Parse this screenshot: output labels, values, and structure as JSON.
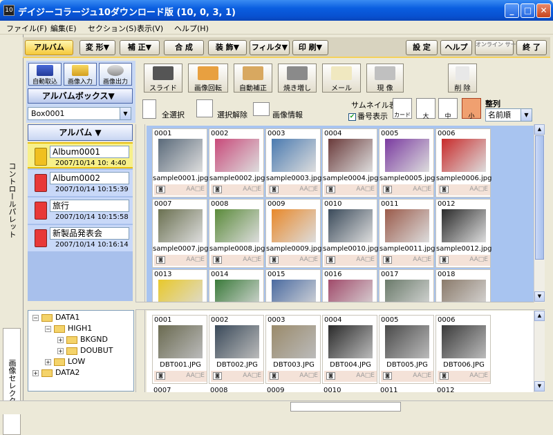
{
  "window": {
    "title": "デイジーコラージュ10ダウンロード版 (10, 0, 3, 1)",
    "app_icon": "10",
    "minimize": "_",
    "maximize": "□",
    "close": "✕"
  },
  "menu": [
    "ファイル(F)",
    "編集(E)",
    "セクション(S)",
    "表示(V)",
    "ヘルプ(H)"
  ],
  "tabs": [
    "アルバム",
    "変 形▼",
    "補 正▼",
    "合 成",
    "装 飾▼",
    "フィルタ▼",
    "印 刷▼"
  ],
  "right_tabs": [
    "設 定",
    "ヘルプ",
    "オンライン サービス",
    "終 了"
  ],
  "left_tools": [
    "自動取込",
    "画像入力",
    "画像出力"
  ],
  "albumbox_label": "アルバムボックス▼",
  "box_select": "Box0001",
  "tools": [
    "スライド",
    "画像回転",
    "自動補正",
    "焼き増し",
    "メール",
    "現 像",
    "削 除"
  ],
  "selection": {
    "select_all": "全選択",
    "deselect": "選択解除",
    "info": "画像情報"
  },
  "thumbnail_display": "サムネイル表示",
  "number_display": "番号表示",
  "card_btn": "カード",
  "size_btns": [
    "大",
    "中",
    "小"
  ],
  "sort": {
    "label": "整列",
    "value": "名前順"
  },
  "album_header": "アルバム ▼",
  "albums": [
    {
      "name": "Album0001",
      "date": "2007/10/14 10: 4:40"
    },
    {
      "name": "Album0002",
      "date": "2007/10/14 10:15:39"
    },
    {
      "name": "旅行",
      "date": "2007/10/14 10:15:58"
    },
    {
      "name": "新製品発表会",
      "date": "2007/10/14 10:16:14"
    }
  ],
  "left_vertical_tabs": [
    "コントロールパレット",
    "画像セレクタ"
  ],
  "thumbnails": [
    {
      "num": "0001",
      "file": "sample0001.jpg",
      "color": "#5a6a7a"
    },
    {
      "num": "0002",
      "file": "sample0002.jpg",
      "color": "#c84a7a"
    },
    {
      "num": "0003",
      "file": "sample0003.jpg",
      "color": "#4a7ab0"
    },
    {
      "num": "0004",
      "file": "sample0004.jpg",
      "color": "#6a3a3a"
    },
    {
      "num": "0005",
      "file": "sample0005.jpg",
      "color": "#7a3aa0"
    },
    {
      "num": "0006",
      "file": "sample0006.jpg",
      "color": "#c82a2a"
    },
    {
      "num": "0007",
      "file": "sample0007.jpg",
      "color": "#6a7050"
    },
    {
      "num": "0008",
      "file": "sample0008.jpg",
      "color": "#5a8a3a"
    },
    {
      "num": "0009",
      "file": "sample0009.jpg",
      "color": "#e8882a"
    },
    {
      "num": "0010",
      "file": "sample0010.jpg",
      "color": "#3a4a5a"
    },
    {
      "num": "0011",
      "file": "sample0011.jpg",
      "color": "#9a5a4a"
    },
    {
      "num": "0012",
      "file": "sample0012.jpg",
      "color": "#2a2a2a"
    },
    {
      "num": "0013",
      "file": "",
      "color": "#e8c82a"
    },
    {
      "num": "0014",
      "file": "",
      "color": "#3a7a3a"
    },
    {
      "num": "0015",
      "file": "",
      "color": "#4a6aa0"
    },
    {
      "num": "0016",
      "file": "",
      "color": "#a04a6a"
    },
    {
      "num": "0017",
      "file": "",
      "color": "#6a7a6a"
    },
    {
      "num": "0018",
      "file": "",
      "color": "#8a7a6a"
    }
  ],
  "thumb_flags": "AA□E",
  "tree": [
    {
      "label": "DATA1",
      "pm": "−",
      "indent": 0
    },
    {
      "label": "HIGH1",
      "pm": "−",
      "indent": 1
    },
    {
      "label": "BKGND",
      "pm": "+",
      "indent": 2
    },
    {
      "label": "DOUBUT",
      "pm": "+",
      "indent": 2
    },
    {
      "label": "LOW",
      "pm": "+",
      "indent": 1
    },
    {
      "label": "DATA2",
      "pm": "+",
      "indent": 0
    }
  ],
  "bottom_thumbnails": [
    {
      "num": "0001",
      "file": "DBT001.JPG",
      "color": "#6a6a50"
    },
    {
      "num": "0002",
      "file": "DBT002.JPG",
      "color": "#3a4a5a"
    },
    {
      "num": "0003",
      "file": "DBT003.JPG",
      "color": "#9a8a6a"
    },
    {
      "num": "0004",
      "file": "DBT004.JPG",
      "color": "#2a2a2a"
    },
    {
      "num": "0005",
      "file": "DBT005.JPG",
      "color": "#4a4a4a"
    },
    {
      "num": "0006",
      "file": "DBT006.JPG",
      "color": "#3a3a3a"
    }
  ],
  "bottom_row2_nums": [
    "0007",
    "0008",
    "0009",
    "0010",
    "0011",
    "0012"
  ]
}
